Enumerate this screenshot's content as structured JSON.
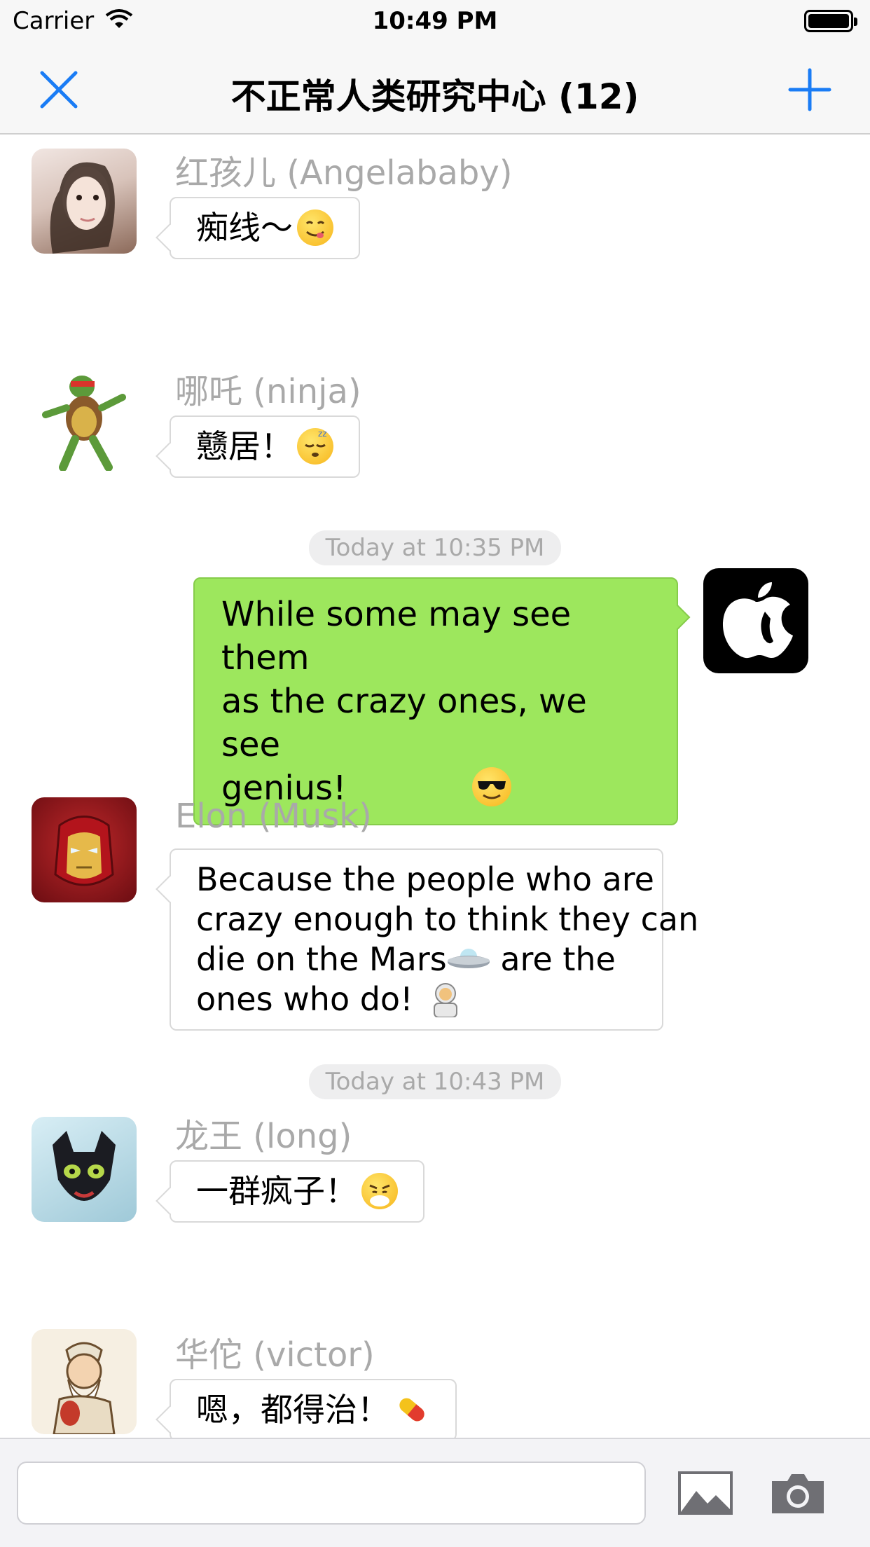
{
  "status_bar": {
    "carrier": "Carrier",
    "time": "10:49 PM"
  },
  "nav": {
    "title": "不正常人类研究中心 (12)",
    "close_icon": "close-icon",
    "add_icon": "plus-icon",
    "accent_color": "#1a7cf5"
  },
  "messages": [
    {
      "sender": "红孩儿 (Angelababy)",
      "text": "痴线～",
      "emoji": "yum-face-emoji"
    },
    {
      "sender": "哪吒 (ninja)",
      "text": "戆居！",
      "emoji": "sleeping-face-emoji"
    },
    {
      "timestamp": "Today at 10:35 PM"
    },
    {
      "outgoing": true,
      "text_lines": [
        "While some may see them",
        "as the crazy ones, we see",
        "genius!"
      ],
      "emoji": "sunglasses-face-emoji"
    },
    {
      "sender": "Elon (Musk)",
      "text_lines": [
        "Because the people who are",
        "crazy enough to think they can",
        "die on the Mars",
        "are the",
        "ones who do!"
      ],
      "emoji": [
        "flying-saucer-emoji",
        "astronaut-emoji"
      ]
    },
    {
      "timestamp": "Today at 10:43 PM"
    },
    {
      "sender": "龙王 (long)",
      "text": "一群疯子！",
      "emoji": "steam-face-emoji"
    },
    {
      "sender": "华佗 (victor)",
      "text": "嗯，都得治！",
      "emoji": "pill-emoji"
    }
  ],
  "input_bar": {
    "placeholder": "",
    "image_icon": "image-icon",
    "camera_icon": "camera-icon"
  },
  "colors": {
    "outgoing_bubble": "#9de75d",
    "sender_name": "#a9a9a9",
    "timestamp_bg": "#eeeeef"
  }
}
